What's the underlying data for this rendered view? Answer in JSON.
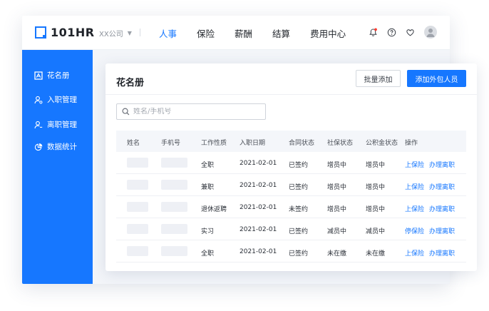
{
  "brand": {
    "name": "101HR"
  },
  "header": {
    "company": "XX公司",
    "nav": [
      "人事",
      "保险",
      "薪酬",
      "结算",
      "费用中心"
    ],
    "active_nav": 0,
    "icons": [
      "bell-icon",
      "help-icon",
      "heart-icon",
      "user-avatar-icon"
    ]
  },
  "sidebar": {
    "items": [
      {
        "label": "花名册",
        "icon": "roster-icon"
      },
      {
        "label": "入职管理",
        "icon": "onboarding-icon"
      },
      {
        "label": "离职管理",
        "icon": "offboarding-icon"
      },
      {
        "label": "数据统计",
        "icon": "chart-pie-icon"
      }
    ]
  },
  "main": {
    "title": "花名册",
    "batch_add_label": "批量添加",
    "add_outsource_label": "添加外包人员",
    "search": {
      "placeholder": "姓名/手机号",
      "value": ""
    },
    "table": {
      "columns": [
        "姓名",
        "手机号",
        "工作性质",
        "入职日期",
        "合同状态",
        "社保状态",
        "公积金状态",
        "操作"
      ],
      "rows": [
        {
          "type": "全职",
          "date": "2021-02-01",
          "contract": "已签约",
          "social": "增员中",
          "fund": "增员中",
          "action1": "上保险",
          "action2": "办理离职"
        },
        {
          "type": "兼职",
          "date": "2021-02-01",
          "contract": "已签约",
          "social": "增员中",
          "fund": "增员中",
          "action1": "上保险",
          "action2": "办理离职"
        },
        {
          "type": "退休返聘",
          "date": "2021-02-01",
          "contract": "未签约",
          "social": "增员中",
          "fund": "增员中",
          "action1": "上保险",
          "action2": "办理离职"
        },
        {
          "type": "实习",
          "date": "2021-02-01",
          "contract": "已签约",
          "social": "减员中",
          "fund": "减员中",
          "action1": "停保险",
          "action2": "办理离职"
        },
        {
          "type": "全职",
          "date": "2021-02-01",
          "contract": "已签约",
          "social": "未在缴",
          "fund": "未在缴",
          "action1": "上保险",
          "action2": "办理离职"
        }
      ]
    }
  },
  "colors": {
    "accent": "#1677ff",
    "notification_dot": "#ff3b30"
  }
}
